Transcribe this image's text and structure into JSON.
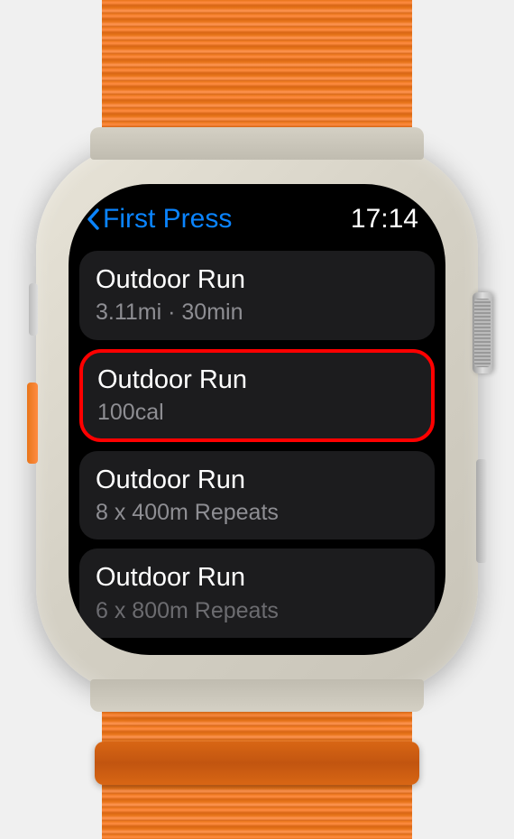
{
  "header": {
    "back_label": "First Press",
    "time": "17:14"
  },
  "workouts": [
    {
      "title": "Outdoor Run",
      "subtitle": "3.11mi · 30min",
      "highlighted": false
    },
    {
      "title": "Outdoor Run",
      "subtitle": "100cal",
      "highlighted": true
    },
    {
      "title": "Outdoor Run",
      "subtitle": "8 x 400m Repeats",
      "highlighted": false
    },
    {
      "title": "Outdoor Run",
      "subtitle": "6 x 800m Repeats",
      "highlighted": false
    }
  ]
}
